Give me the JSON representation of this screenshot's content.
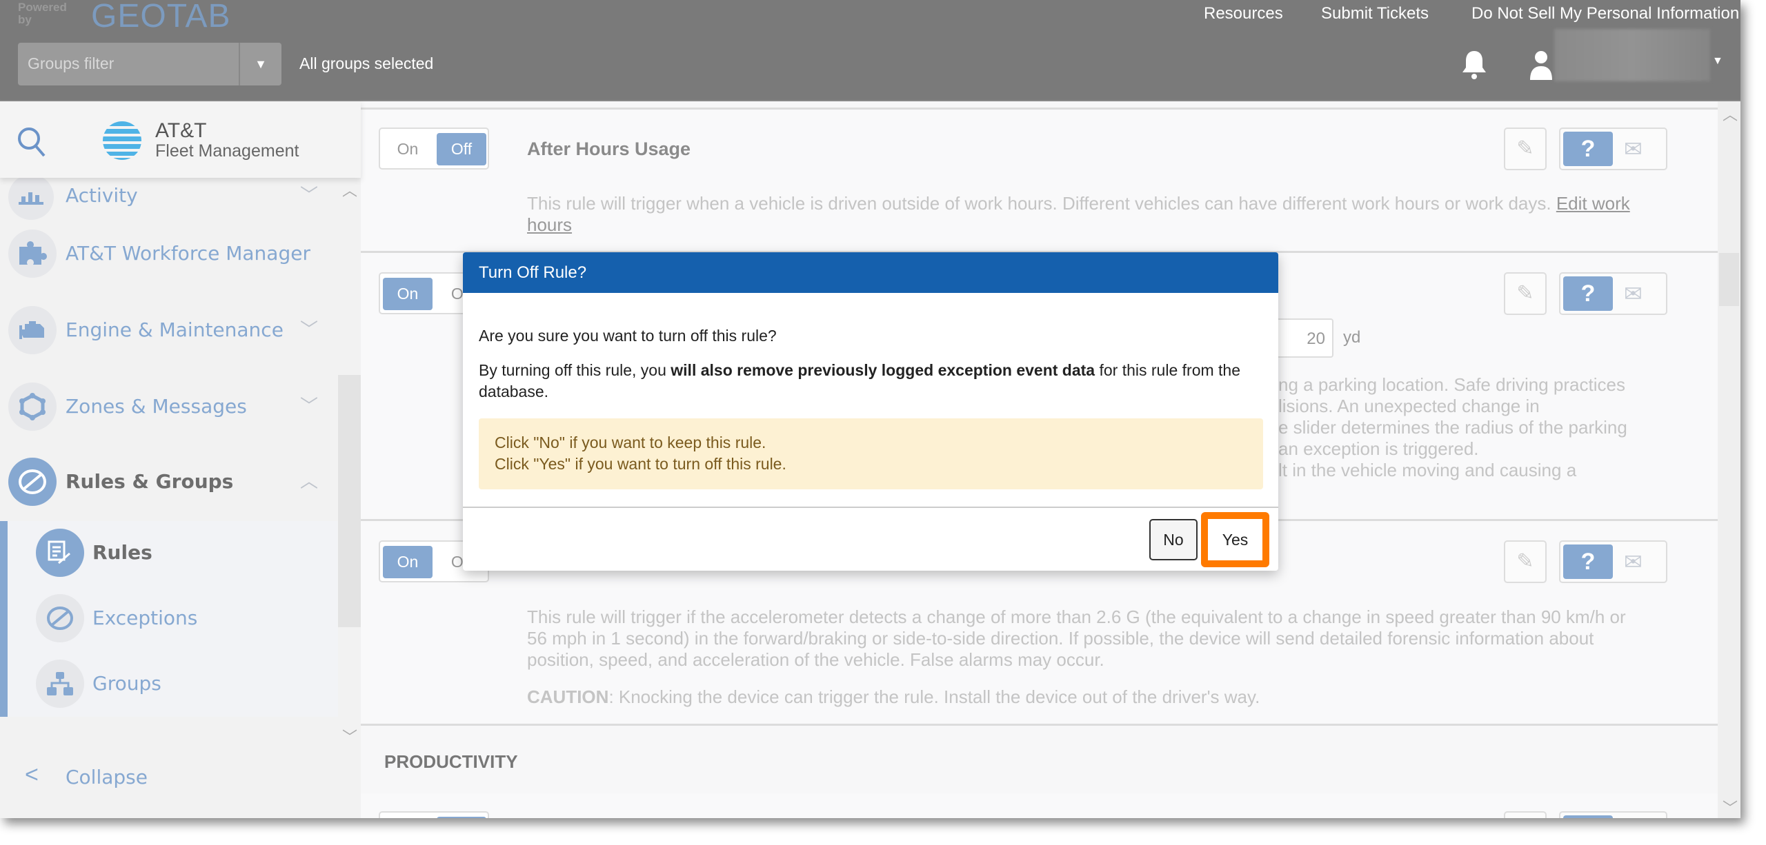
{
  "header": {
    "powered_by": "Powered by",
    "brand": "GEOTAB",
    "links": [
      "Resources",
      "Submit Tickets",
      "Do Not Sell My Personal Information"
    ],
    "groups_filter_placeholder": "Groups filter",
    "groups_status": "All groups selected"
  },
  "sidebar": {
    "logo_title": "AT&T",
    "logo_subtitle": "Fleet Management",
    "items": [
      {
        "label": "Activity",
        "icon": "bar-chart-icon"
      },
      {
        "label": "AT&T Workforce Manager",
        "icon": "puzzle-icon"
      },
      {
        "label": "Engine & Maintenance",
        "icon": "engine-icon"
      },
      {
        "label": "Zones & Messages",
        "icon": "zones-icon"
      },
      {
        "label": "Rules & Groups",
        "icon": "no-entry-icon"
      }
    ],
    "subitems": [
      {
        "label": "Rules"
      },
      {
        "label": "Exceptions"
      },
      {
        "label": "Groups"
      }
    ],
    "collapse": "Collapse"
  },
  "main": {
    "toggle_on": "On",
    "toggle_off": "Off",
    "rule1": {
      "title": "After Hours Usage",
      "desc": "This rule will trigger when a vehicle is driven outside of work hours. Different vehicles can have different work hours or work days. ",
      "link": "Edit work hours",
      "state": "off"
    },
    "rule2": {
      "value": "20",
      "unit": "yd",
      "fragments": [
        "ng a parking location. Safe driving practices",
        "lisions. An unexpected change in",
        "e slider determines the radius of the parking",
        "an exception is triggered.",
        "lt in the vehicle moving and causing a"
      ],
      "state": "on"
    },
    "rule3": {
      "desc": "This rule will trigger if the accelerometer detects a change of more than 2.6 G (the equivalent to a change in speed greater than 90 km/h or 56 mph in 1 second) in the forward/braking or side-to-side direction. If possible, the device will send detailed forensic information about position, speed, and acceleration of the vehicle. False alarms may occur.",
      "caution_label": "CAUTION",
      "caution": ": Knocking the device can trigger the rule. Install the device out of the driver's way.",
      "state": "on"
    },
    "section": "PRODUCTIVITY"
  },
  "dialog": {
    "title": "Turn Off Rule?",
    "question": "Are you sure you want to turn off this rule?",
    "p_pre": "By turning off this rule, you ",
    "p_bold": "will also remove previously logged exception event data",
    "p_post": " for this rule from the database.",
    "warn1": "Click \"No\" if you want to keep this rule.",
    "warn2": "Click \"Yes\" if you want to turn off this rule.",
    "no": "No",
    "yes": "Yes"
  },
  "colors": {
    "header": "#7a7a7a",
    "dialog_header": "#1560ad",
    "accent": "#86a8d1",
    "highlight": "#ff7a00",
    "warning_bg": "#fdf1d3"
  }
}
